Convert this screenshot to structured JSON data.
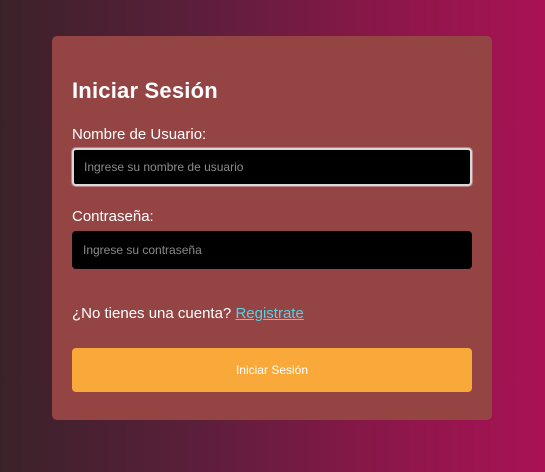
{
  "colors": {
    "card_background": "#954444",
    "field_background": "#000000",
    "button_background": "#f8a93a",
    "link": "#4fd3e8",
    "text": "#ffffff"
  },
  "login": {
    "title": "Iniciar Sesión",
    "username": {
      "label": "Nombre de Usuario:",
      "placeholder": "Ingrese su nombre de usuario",
      "value": ""
    },
    "password": {
      "label": "Contraseña:",
      "placeholder": "Ingrese su contraseña",
      "value": ""
    },
    "signup_prompt": "¿No tienes una cuenta?",
    "signup_link": "Registrate",
    "submit_label": "Iniciar Sesión"
  }
}
